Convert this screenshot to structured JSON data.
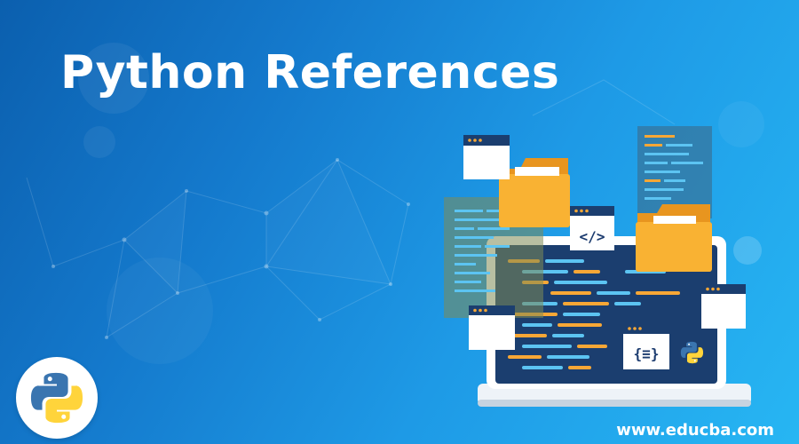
{
  "banner": {
    "title": "Python References",
    "website": "www.educba.com"
  },
  "code_glyphs": {
    "html_tag": "</>",
    "json_braces": "{≡}"
  },
  "colors": {
    "background_start": "#0b5fae",
    "background_end": "#27b6f3",
    "title": "#ffffff",
    "laptop_screen": "#1b3e6f",
    "code_orange": "#f7a736",
    "code_blue": "#5cc4f2",
    "folder": "#f9b233",
    "python_blue": "#3a75b0",
    "python_yellow": "#ffd43b"
  },
  "icons": [
    "python-logo-icon",
    "folder-icon",
    "code-window-icon",
    "laptop-icon"
  ]
}
